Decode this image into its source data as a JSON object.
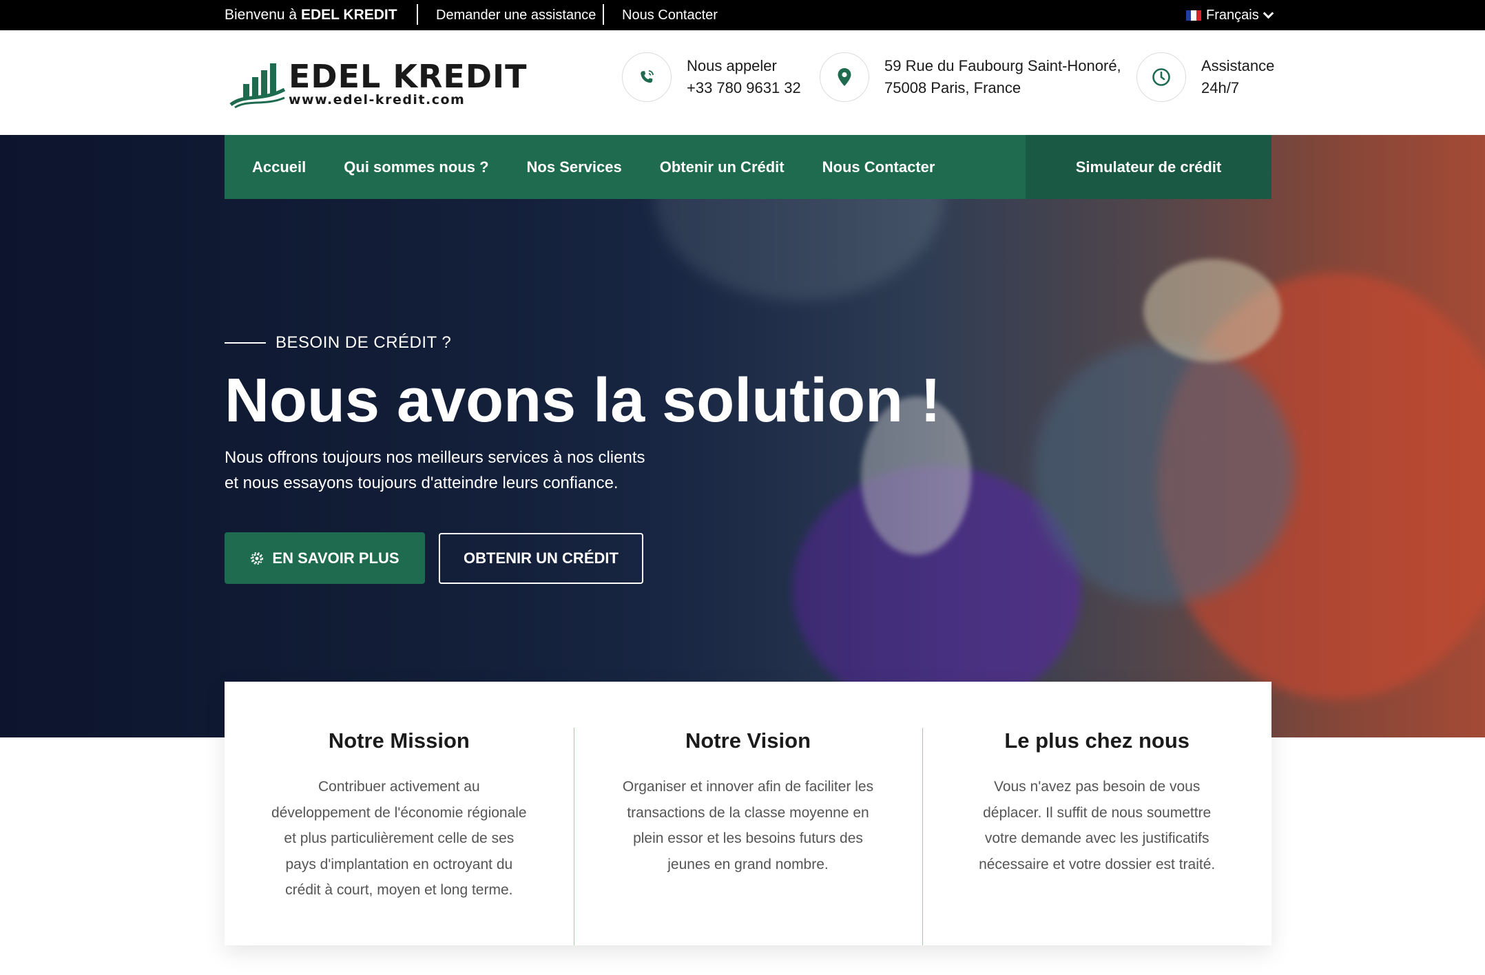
{
  "colors": {
    "brand_green": "#1f6b50",
    "brand_green_dark": "#1a5a44",
    "topbar": "#000000",
    "divider": "#9ed0ae"
  },
  "topbar": {
    "welcome_prefix": "Bienvenu à",
    "welcome_brand": "EDEL KREDIT",
    "links": [
      "Demander une assistance",
      "Nous Contacter"
    ],
    "language": "Français"
  },
  "header": {
    "logo_name": "EDEL KREDIT",
    "logo_url": "www.edel-kredit.com",
    "phone": {
      "icon": "phone-icon",
      "label": "Nous appeler",
      "value": "+33 780 9631 32"
    },
    "address": {
      "icon": "location-pin-icon",
      "line1": "59 Rue du Faubourg Saint-Honoré,",
      "line2": "75008 Paris, France"
    },
    "assistance": {
      "icon": "clock-icon",
      "line1": "Assistance",
      "line2": "24h/7"
    }
  },
  "nav": {
    "items": [
      "Accueil",
      "Qui sommes nous ?",
      "Nos Services",
      "Obtenir un Crédit",
      "Nous Contacter"
    ],
    "cta": "Simulateur de crédit"
  },
  "hero": {
    "eyebrow": "BESOIN DE CRÉDIT ?",
    "headline": "Nous avons la solution !",
    "sub_line1": "Nous offrons toujours nos meilleurs services à nos clients",
    "sub_line2": "et nous essayons toujours d'atteindre leurs confiance.",
    "primary_button": "EN SAVOIR PLUS",
    "secondary_button": "OBTENIR UN CRÉDIT"
  },
  "features": [
    {
      "title": "Notre Mission",
      "text": "Contribuer activement au développement de l'économie régionale et plus particulièrement celle de ses pays d'implantation en octroyant du crédit à court, moyen et long terme."
    },
    {
      "title": "Notre Vision",
      "text": "Organiser et innover afin de faciliter les transactions de la classe moyenne en plein essor et les besoins futurs des jeunes en grand nombre."
    },
    {
      "title": "Le plus chez nous",
      "text": "Vous n'avez pas besoin de vous déplacer. Il suffit de nous soumettre votre demande avec les justificatifs nécessaire et votre dossier est traité."
    }
  ]
}
